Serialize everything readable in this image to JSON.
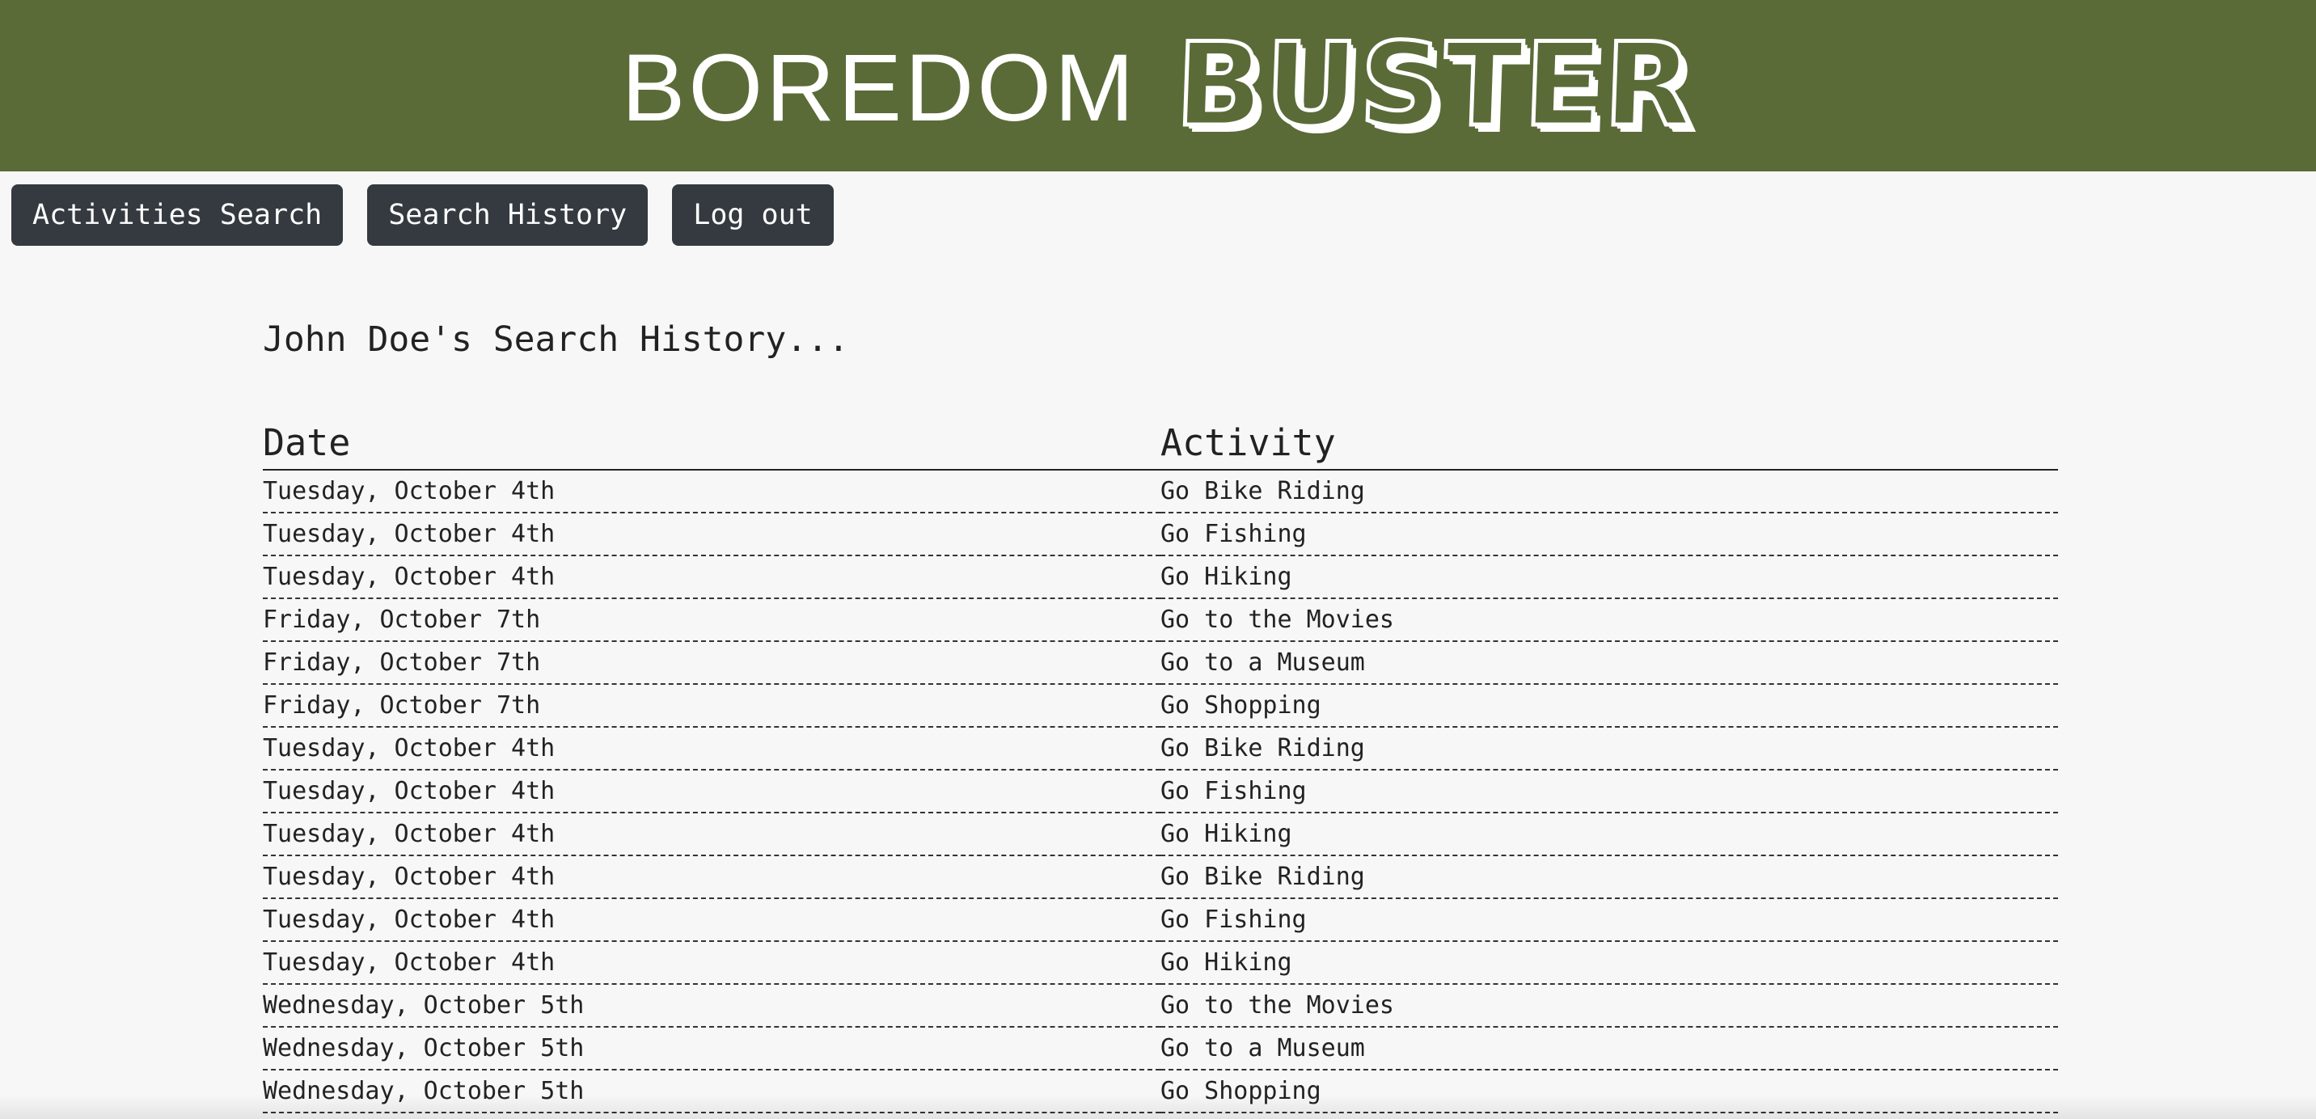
{
  "header": {
    "logo_word1": "BOREDOM",
    "logo_word2": "BUSTER",
    "background_color": "#5a6b38"
  },
  "nav": {
    "activities_search": "Activities Search",
    "search_history": "Search History",
    "log_out": "Log out"
  },
  "page": {
    "heading": "John Doe's Search History..."
  },
  "table": {
    "columns": [
      "Date",
      "Activity"
    ],
    "rows": [
      {
        "date": "Tuesday, October 4th",
        "activity": "Go Bike Riding"
      },
      {
        "date": "Tuesday, October 4th",
        "activity": "Go Fishing"
      },
      {
        "date": "Tuesday, October 4th",
        "activity": "Go Hiking"
      },
      {
        "date": "Friday, October 7th",
        "activity": "Go to the Movies"
      },
      {
        "date": "Friday, October 7th",
        "activity": "Go to a Museum"
      },
      {
        "date": "Friday, October 7th",
        "activity": "Go Shopping"
      },
      {
        "date": "Tuesday, October 4th",
        "activity": "Go Bike Riding"
      },
      {
        "date": "Tuesday, October 4th",
        "activity": "Go Fishing"
      },
      {
        "date": "Tuesday, October 4th",
        "activity": "Go Hiking"
      },
      {
        "date": "Tuesday, October 4th",
        "activity": "Go Bike Riding"
      },
      {
        "date": "Tuesday, October 4th",
        "activity": "Go Fishing"
      },
      {
        "date": "Tuesday, October 4th",
        "activity": "Go Hiking"
      },
      {
        "date": "Wednesday, October 5th",
        "activity": "Go to the Movies"
      },
      {
        "date": "Wednesday, October 5th",
        "activity": "Go to a Museum"
      },
      {
        "date": "Wednesday, October 5th",
        "activity": "Go Shopping"
      }
    ]
  }
}
